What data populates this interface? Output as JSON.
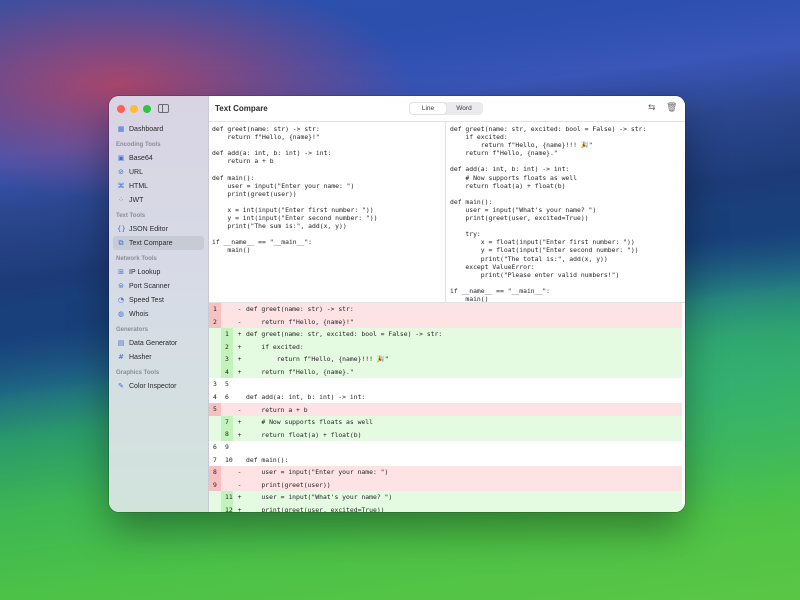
{
  "window": {
    "title": "Text Compare",
    "view_modes": [
      "Line",
      "Word"
    ],
    "active_mode": "Line",
    "icons": [
      "swap-icon",
      "trash-icon"
    ]
  },
  "sidebar": {
    "sections": [
      {
        "title": "",
        "items": [
          {
            "label": "Dashboard",
            "icon": "grid-icon",
            "glyph": "▦"
          }
        ]
      },
      {
        "title": "Encoding Tools",
        "items": [
          {
            "label": "Base64",
            "icon": "base64-icon",
            "glyph": "▣"
          },
          {
            "label": "URL",
            "icon": "link-icon",
            "glyph": "⊘"
          },
          {
            "label": "HTML",
            "icon": "code-icon",
            "glyph": "⌘"
          },
          {
            "label": "JWT",
            "icon": "key-icon",
            "glyph": "⁘"
          }
        ]
      },
      {
        "title": "Text Tools",
        "items": [
          {
            "label": "JSON Editor",
            "icon": "braces-icon",
            "glyph": "{}"
          },
          {
            "label": "Text Compare",
            "icon": "compare-icon",
            "glyph": "⧉",
            "active": true
          }
        ]
      },
      {
        "title": "Network Tools",
        "items": [
          {
            "label": "IP Lookup",
            "icon": "network-icon",
            "glyph": "⊞"
          },
          {
            "label": "Port Scanner",
            "icon": "scanner-icon",
            "glyph": "⊜"
          },
          {
            "label": "Speed Test",
            "icon": "gauge-icon",
            "glyph": "◔"
          },
          {
            "label": "Whois",
            "icon": "globe-icon",
            "glyph": "◍"
          }
        ]
      },
      {
        "title": "Generators",
        "items": [
          {
            "label": "Data Generator",
            "icon": "table-icon",
            "glyph": "▤"
          },
          {
            "label": "Hasher",
            "icon": "hash-icon",
            "glyph": "#"
          }
        ]
      },
      {
        "title": "Graphics Tools",
        "items": [
          {
            "label": "Color Inspector",
            "icon": "eyedropper-icon",
            "glyph": "✎"
          }
        ]
      }
    ]
  },
  "left_text": "def greet(name: str) -> str:\n    return f\"Hello, {name}!\"\n\ndef add(a: int, b: int) -> int:\n    return a + b\n\ndef main():\n    user = input(\"Enter your name: \")\n    print(greet(user))\n\n    x = int(input(\"Enter first number: \"))\n    y = int(input(\"Enter second number: \"))\n    print(\"The sum is:\", add(x, y))\n\nif __name__ == \"__main__\":\n    main()",
  "right_text": "def greet(name: str, excited: bool = False) -> str:\n    if excited:\n        return f\"Hello, {name}!!! 🎉\"\n    return f\"Hello, {name}.\"\n\ndef add(a: int, b: int) -> int:\n    # Now supports floats as well\n    return float(a) + float(b)\n\ndef main():\n    user = input(\"What's your name? \")\n    print(greet(user, excited=True))\n\n    try:\n        x = float(input(\"Enter first number: \"))\n        y = float(input(\"Enter second number: \"))\n        print(\"The total is:\", add(x, y))\n    except ValueError:\n        print(\"Please enter valid numbers!\")\n\nif __name__ == \"__main__\":\n    main()",
  "diff": [
    {
      "type": "removed",
      "old": "1",
      "new": "",
      "sign": "-",
      "text": "def greet(name: str) -> str:"
    },
    {
      "type": "removed",
      "old": "2",
      "new": "",
      "sign": "-",
      "text": "    return f\"Hello, {name}!\""
    },
    {
      "type": "added",
      "old": "",
      "new": "1",
      "sign": "+",
      "text": "def greet(name: str, excited: bool = False) -> str:"
    },
    {
      "type": "added",
      "old": "",
      "new": "2",
      "sign": "+",
      "text": "    if excited:"
    },
    {
      "type": "added",
      "old": "",
      "new": "3",
      "sign": "+",
      "text": "        return f\"Hello, {name}!!! 🎉\""
    },
    {
      "type": "added",
      "old": "",
      "new": "4",
      "sign": "+",
      "text": "    return f\"Hello, {name}.\""
    },
    {
      "type": "same",
      "old": "3",
      "new": "5",
      "sign": "",
      "text": ""
    },
    {
      "type": "same",
      "old": "4",
      "new": "6",
      "sign": "",
      "text": "def add(a: int, b: int) -> int:"
    },
    {
      "type": "removed",
      "old": "5",
      "new": "",
      "sign": "-",
      "text": "    return a + b"
    },
    {
      "type": "added",
      "old": "",
      "new": "7",
      "sign": "+",
      "text": "    # Now supports floats as well"
    },
    {
      "type": "added",
      "old": "",
      "new": "8",
      "sign": "+",
      "text": "    return float(a) + float(b)"
    },
    {
      "type": "same",
      "old": "6",
      "new": "9",
      "sign": "",
      "text": ""
    },
    {
      "type": "same",
      "old": "7",
      "new": "10",
      "sign": "",
      "text": "def main():"
    },
    {
      "type": "removed",
      "old": "8",
      "new": "",
      "sign": "-",
      "text": "    user = input(\"Enter your name: \")"
    },
    {
      "type": "removed",
      "old": "9",
      "new": "",
      "sign": "-",
      "text": "    print(greet(user))"
    },
    {
      "type": "added",
      "old": "",
      "new": "11",
      "sign": "+",
      "text": "    user = input(\"What's your name? \")"
    },
    {
      "type": "added",
      "old": "",
      "new": "12",
      "sign": "+",
      "text": "    print(greet(user, excited=True))"
    }
  ],
  "colors": {
    "removed_bg": "#fde3e4",
    "removed_gutter": "#f7c1c4",
    "added_bg": "#e5fbe1",
    "added_gutter": "#c4f2bc",
    "accent": "#3d6fd6"
  }
}
